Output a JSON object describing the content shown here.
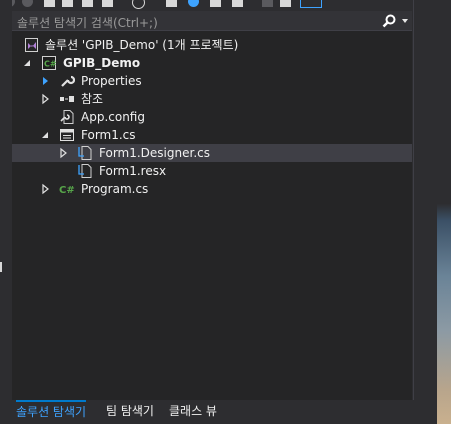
{
  "search": {
    "placeholder": "솔루션 탐색기 검색(Ctrl+;)"
  },
  "tree": {
    "solution": "솔루션 'GPIB_Demo' (1개 프로젝트)",
    "project": "GPIB_Demo",
    "properties": "Properties",
    "references": "참조",
    "app_config": "App.config",
    "form1": "Form1.cs",
    "form1_designer": "Form1.Designer.cs",
    "form1_resx": "Form1.resx",
    "program": "Program.cs"
  },
  "tabs": {
    "solution_explorer": "솔루션 탐색기",
    "team_explorer": "팀 탐색기",
    "class_view": "클래스 뷰"
  },
  "colors": {
    "accent": "#007acc",
    "selected_row": "#3f3f46",
    "cs_icon": "#57a64a"
  }
}
